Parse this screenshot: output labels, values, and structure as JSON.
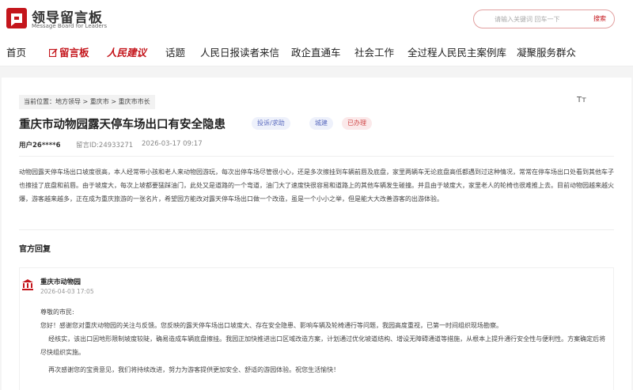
{
  "header": {
    "logo_title": "领导留言板",
    "logo_sub": "Message Board for Leaders",
    "search_placeholder": "请输入关键词 回车一下",
    "search_button": "搜索"
  },
  "nav": {
    "items": [
      "首页",
      "留言板",
      "人民建议",
      "话题",
      "人民日报读者来信",
      "政企直通车",
      "社会工作",
      "全过程人民民主案例库",
      "凝聚服务群众"
    ]
  },
  "breadcrumb": "当前位置：地方领导 > 重庆市 > 重庆市市长",
  "font_size_icon": "Tт",
  "message": {
    "title": "重庆市动物园露天停车场出口有安全隐患",
    "tags": [
      "投诉/求助",
      "城建",
      "已办理"
    ],
    "user": "用户26****6",
    "id_label": "留言ID:24933271",
    "time": "2026-03-17 09:17",
    "body": "动物园露天停车场出口坡度很高，本人经常带小孩和老人来动物园游玩，每次出停车场尽管很小心，还是多次擦挂到车辆前唇及底盘，家里两辆车无论底盘高低都遇到过这种情况，常常在停车场出口处看到其他车子也擦挂了底盘和前唇。由于坡度大，每次上坡都要猛踩油门，此处又是道路的一个弯道，油门大了速度快很容易和道路上的其他车辆发生碰撞。并且由于坡度大，家里老人的轮椅也很难推上去。目前动物园越来越火爆，游客越来越多，正在成为重庆旅游的一张名片，希望园方能改对露天停车场出口做一个改造，虽是一个小小之举，但是能大大改善游客的出游体验。"
  },
  "reply": {
    "section_title": "官方回复",
    "org": "重庆市动物园",
    "date": "2026-04-03 17:05",
    "greeting": "尊敬的市民:",
    "p1": "您好！感谢您对重庆动物园的关注与反馈。您反映的露天停车场出口坡度大、存在安全隐患、影响车辆及轮椅通行等问题，我园高度重视，已第一时间组织现场勘察。",
    "p2": "    经核实，该出口因地形限制坡度较陡，确易造成车辆底盘擦挂。我园正加快推进出口区域改造方案，计划通过优化坡道结构、增设无障碍通道等措施，从根本上提升通行安全性与便利性。方案确定后将尽快组织实施。",
    "p3": "    再次感谢您的宝贵意见，我们将持续改进，努力为游客提供更加安全、舒适的游园体验。祝您生活愉快！"
  },
  "colors": {
    "brand_red": "#c4161c"
  }
}
